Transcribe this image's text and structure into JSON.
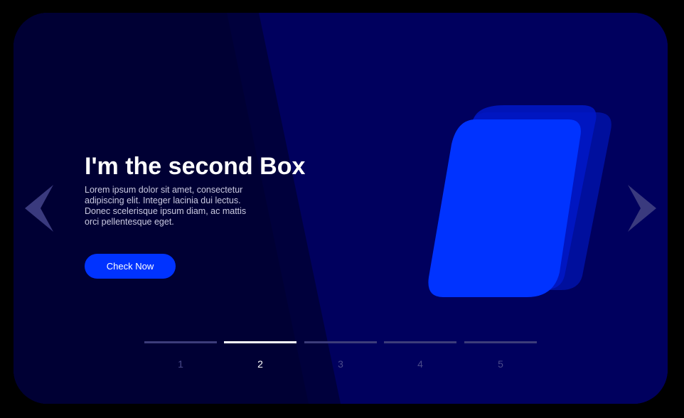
{
  "slide": {
    "title": "I'm the second Box",
    "description": "Lorem ipsum dolor sit amet, consectetur adipiscing elit. Integer lacinia dui lectus. Donec scelerisque ipsum diam, ac mattis orci pellentesque eget.",
    "button_label": "Check Now"
  },
  "navigation": {
    "prev_icon": "chevron-left-icon",
    "next_icon": "chevron-right-icon"
  },
  "pagination": {
    "active_index": 2,
    "items": [
      {
        "label": "1"
      },
      {
        "label": "2"
      },
      {
        "label": "3"
      },
      {
        "label": "4"
      },
      {
        "label": "5"
      }
    ]
  },
  "colors": {
    "page_background": "#000000",
    "slider_background": "#000055",
    "dark_panel": "#00003a",
    "accent": "#0033ff",
    "card_back": "#0a1fb8",
    "inactive_indicator": "#3c3c7a",
    "active_indicator": "#ffffff"
  }
}
